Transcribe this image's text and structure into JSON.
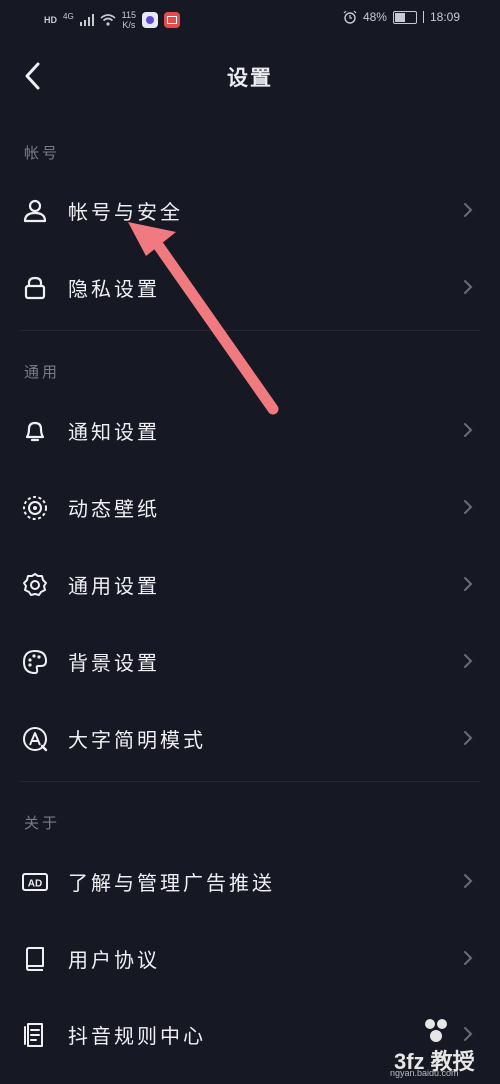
{
  "status_bar": {
    "hd": "HD",
    "network": "4G",
    "speed_value": "115",
    "speed_unit": "K/s",
    "battery": "48%",
    "time": "18:09"
  },
  "nav": {
    "title": "设置",
    "back_icon": "chevron-left-icon"
  },
  "sections": [
    {
      "header": "帐号",
      "items": [
        {
          "label": "帐号与安全",
          "icon": "user-icon"
        },
        {
          "label": "隐私设置",
          "icon": "lock-icon"
        }
      ]
    },
    {
      "header": "通用",
      "items": [
        {
          "label": "通知设置",
          "icon": "bell-icon"
        },
        {
          "label": "动态壁纸",
          "icon": "concentric-circle-icon"
        },
        {
          "label": "通用设置",
          "icon": "gear-icon"
        },
        {
          "label": "背景设置",
          "icon": "palette-icon"
        },
        {
          "label": "大字简明模式",
          "icon": "font-a-icon"
        }
      ]
    },
    {
      "header": "关于",
      "items": [
        {
          "label": "了解与管理广告推送",
          "icon": "ad-icon"
        },
        {
          "label": "用户协议",
          "icon": "book-icon"
        },
        {
          "label": "抖音规则中心",
          "icon": "document-icon"
        }
      ]
    }
  ],
  "colors": {
    "background": "#161823",
    "arrow": "#f07a80",
    "text": "#ececf0",
    "muted": "#7a7b84"
  },
  "watermark": {
    "text": "3fz 教授",
    "url": "ngyan.baidu.com"
  }
}
